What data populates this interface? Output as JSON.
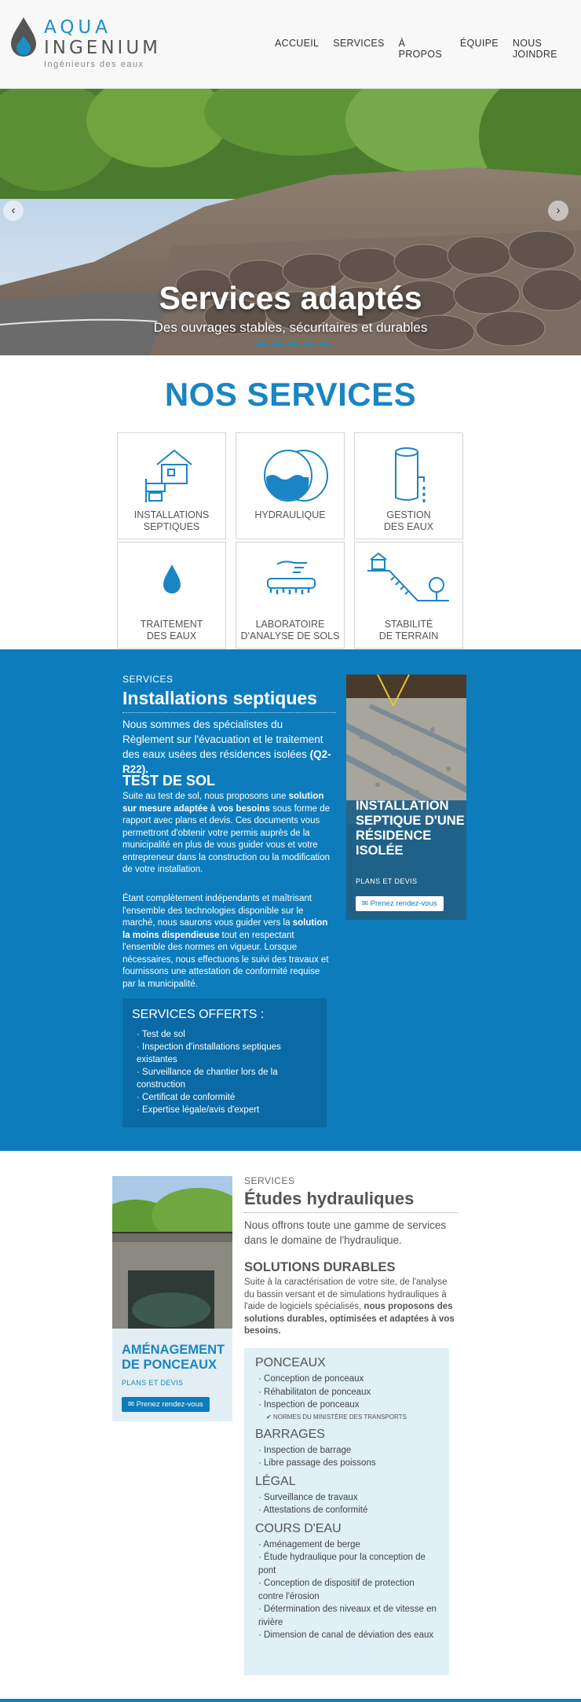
{
  "brand": {
    "name_line1": "AQUA",
    "name_line2": "INGENIUM",
    "tagline": "Ingénieurs des eaux",
    "color_primary": "#1a85c2",
    "color_dark_blue": "#0c7cbd"
  },
  "nav": {
    "items": [
      "ACCUEIL",
      "SERVICES",
      "À PROPOS",
      "ÉQUIPE",
      "NOUS JOINDRE"
    ]
  },
  "hero": {
    "title": "Services adaptés",
    "subtitle": "Des ouvrages stables, sécuritaires et durables",
    "prev_icon": "chevron-left-icon",
    "next_icon": "chevron-right-icon"
  },
  "services": {
    "title": "NOS SERVICES",
    "tiles": [
      {
        "line1": "INSTALLATIONS",
        "line2": "SEPTIQUES",
        "icon": "house-septic-icon"
      },
      {
        "line1": "HYDRAULIQUE",
        "line2": "",
        "icon": "water-pipe-icon"
      },
      {
        "line1": "GESTION",
        "line2": "DES EAUX",
        "icon": "water-tank-icon"
      },
      {
        "line1": "TRAITEMENT",
        "line2": "DES EAUX",
        "icon": "water-drop-icon"
      },
      {
        "line1": "LABORATOIRE",
        "line2": "D'ANALYSE DE SOLS",
        "icon": "soil-lab-icon"
      },
      {
        "line1": "STABILITÉ",
        "line2": "DE TERRAIN",
        "icon": "slope-stability-icon"
      }
    ]
  },
  "septic": {
    "kicker": "SERVICES",
    "title": "Installations septiques",
    "lead": "Nous sommes des spécialistes du Règlement sur l'évacuation et le traitement des eaux usées des résidences isolées",
    "lead_bold": "(Q2-R22).",
    "h3": "TEST DE SOL",
    "p1_a": "Suite au test de sol, nous proposons une ",
    "p1_bold": "solution sur mesure adaptée à vos besoins",
    "p1_b": " sous forme de rapport avec plans et devis. Ces documents vous permettront d'obtenir votre permis auprès de la municipalité en plus de vous guider vous et votre entrepreneur dans la construction ou la modification de votre installation.",
    "p2_a": "Étant complètement indépendants et maîtrisant l'ensemble des technologies disponible sur le marché, nous saurons vous guider vers la ",
    "p2_bold": "solution la moins dispendieuse",
    "p2_b": " tout en respectant l'ensemble des normes en vigueur. Lorsque nécessaires, nous effectuons le suivi des travaux et fournissons une attestation de conformité requise par la municipalité.",
    "offered_title": "SERVICES OFFERTS :",
    "offered": [
      "Test de sol",
      "Inspection d'installations septiques existantes",
      "Surveillance de chantier lors de la construction",
      "Certificat de conformité",
      "Expertise légale/avis d'expert"
    ],
    "promo": {
      "title": "INSTALLATION SEPTIQUE D'UNE RÉSIDENCE ISOLÉE",
      "sub": "PLANS ET DEVIS",
      "button": "Prenez rendez-vous"
    }
  },
  "hydro": {
    "kicker": "SERVICES",
    "title": "Études hydrauliques",
    "lead": "Nous offrons toute une gamme de services dans le domaine de l'hydraulique.",
    "h3": "SOLUTIONS DURABLES",
    "p_a": "Suite à la caractérisation de votre site, de l'analyse du bassin versant et de simulations hydrauliques à l'aide de logiciels spécialisés, ",
    "p_bold": "nous proposons des solutions durables, optimisées et adaptées à vos besoins.",
    "categories": [
      {
        "name": "PONCEAUX",
        "items": [
          "Conception de ponceaux",
          "Réhabilitaton de ponceaux",
          "Inspection de ponceaux"
        ],
        "note": "NORMES DU MINISTÈRE DES TRANSPORTS"
      },
      {
        "name": "BARRAGES",
        "items": [
          "Inspection de barrage",
          "Libre passage des poissons"
        ]
      },
      {
        "name": "LÉGAL",
        "items": [
          "Surveillance de travaux",
          "Attestations de conformité"
        ]
      },
      {
        "name": "COURS D'EAU",
        "items": [
          "Aménagement de berge",
          "Étude hydraulique pour la conception de pont",
          "Conception de dispositif de protection contre l'érosion",
          "Détermination des niveaux et de vitesse en rivière",
          "Dimension de canal de déviation des eaux"
        ]
      }
    ],
    "promo": {
      "title": "AMÉNAGEMENT DE PONCEAUX",
      "sub": "PLANS ET DEVIS",
      "button": "Prenez rendez-vous"
    }
  }
}
